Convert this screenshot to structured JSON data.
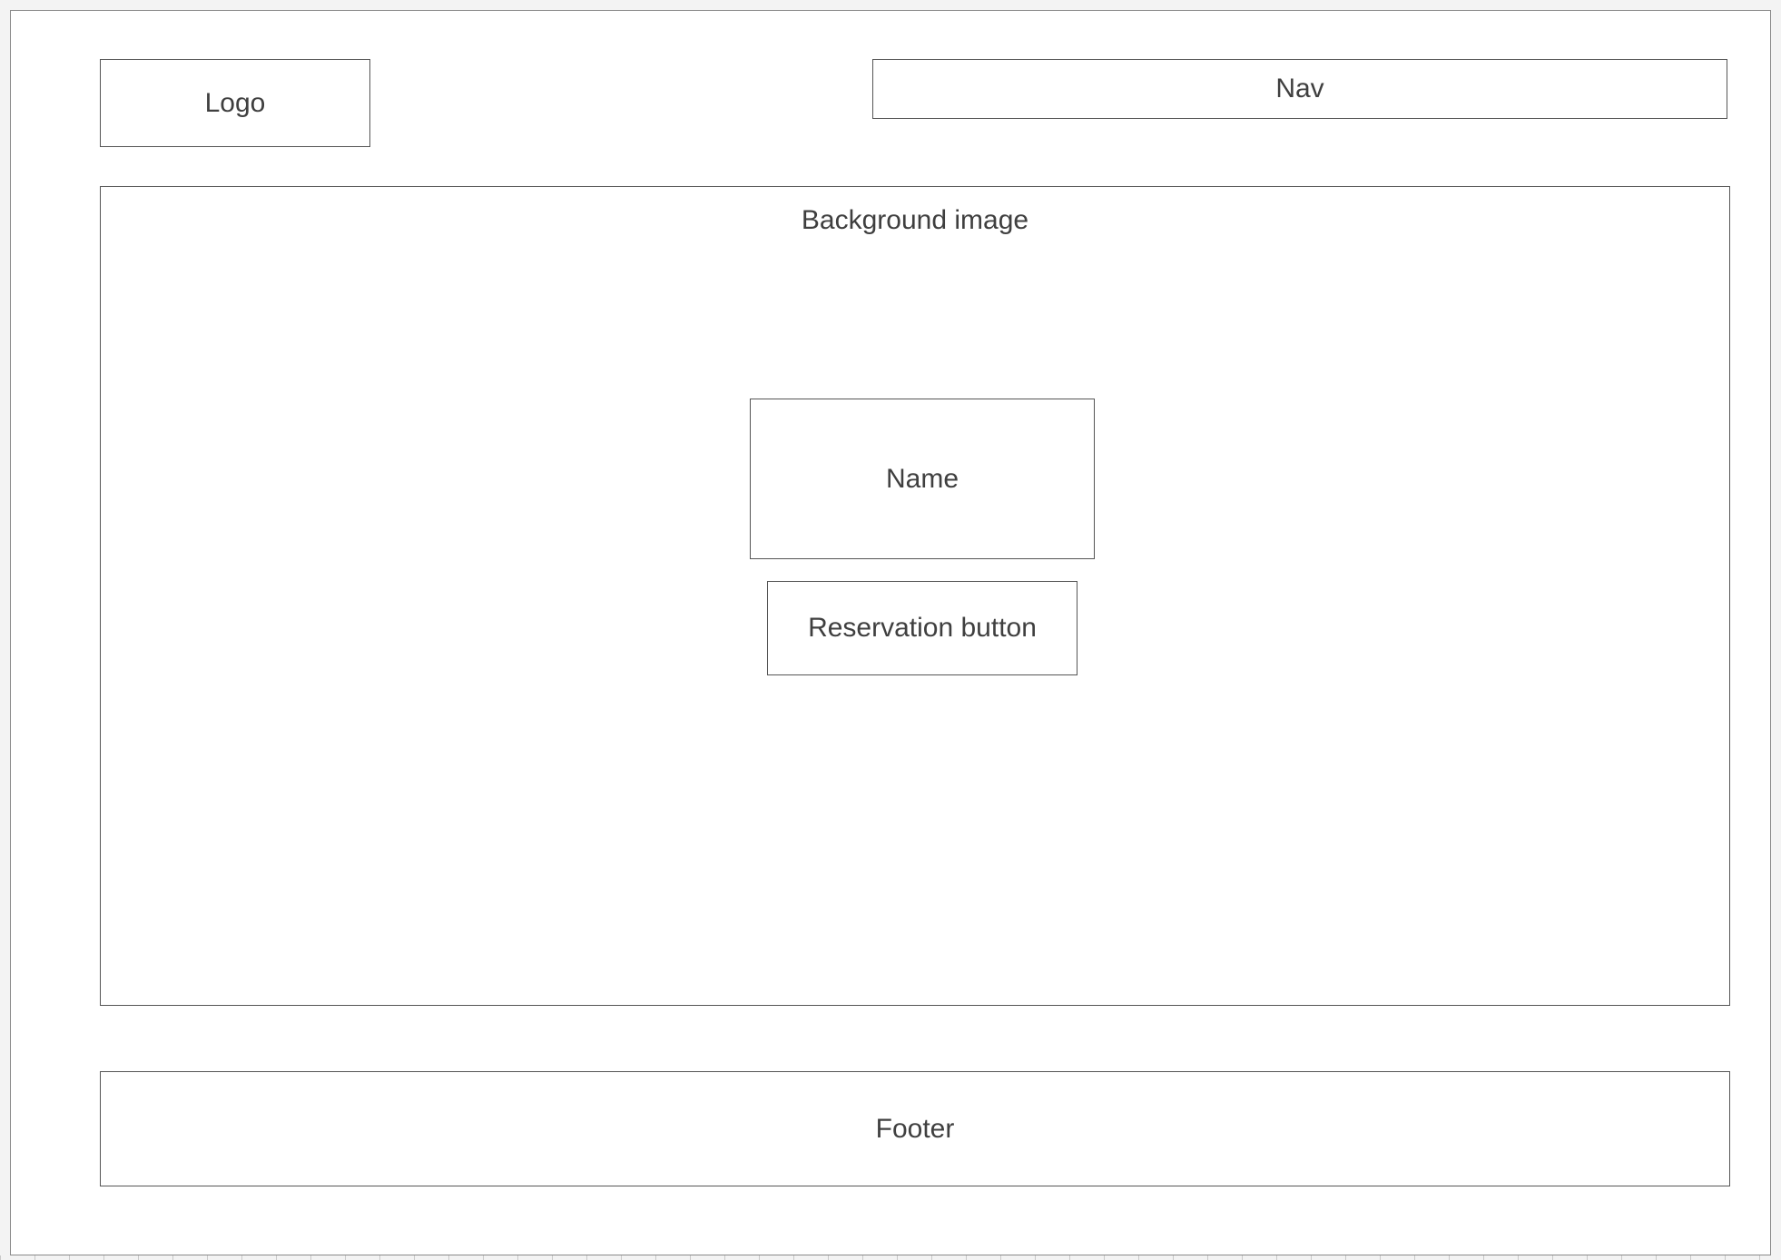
{
  "wireframe": {
    "logo_label": "Logo",
    "nav_label": "Nav",
    "hero": {
      "background_label": "Background image",
      "name_label": "Name",
      "reservation_label": "Reservation button"
    },
    "footer_label": "Footer"
  },
  "colors": {
    "border": "#555555",
    "text": "#3f3f3f",
    "page_background": "#ffffff",
    "canvas_background": "#e6e6e6"
  }
}
